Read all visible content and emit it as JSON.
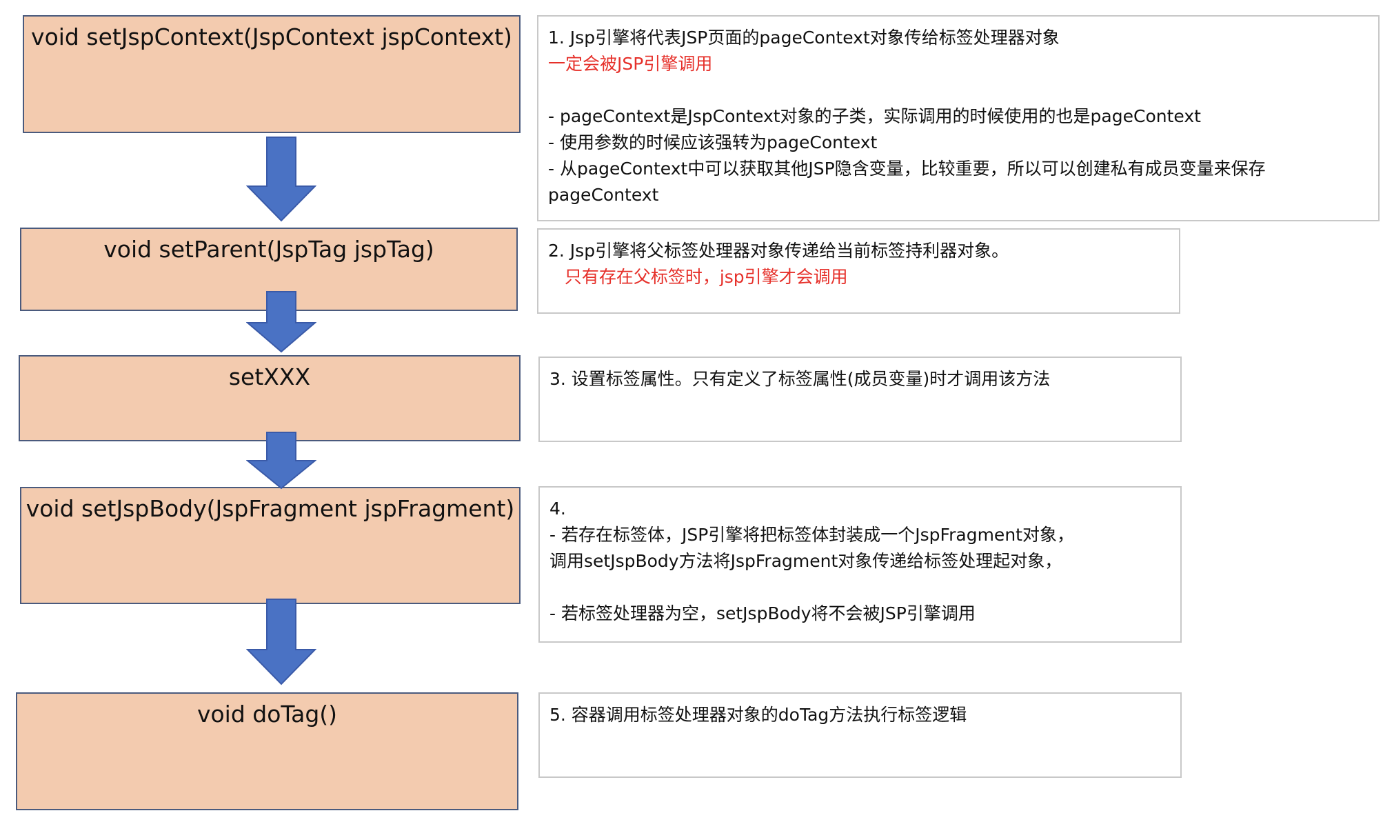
{
  "colors": {
    "step_fill": "#f3cbaf",
    "step_border": "#4a5a7d",
    "arrow_fill": "#4a72c4",
    "arrow_stroke": "#3a5aa8",
    "note_border": "#c8c8c8",
    "highlight_text": "#e6302a"
  },
  "steps": [
    {
      "label": "void setJspContext(JspContext jspContext)"
    },
    {
      "label": "void setParent(JspTag jspTag)"
    },
    {
      "label": "setXXX"
    },
    {
      "label": "void setJspBody(JspFragment jspFragment)"
    },
    {
      "label": "void doTag()"
    }
  ],
  "notes": [
    {
      "lines": [
        {
          "text": "1. Jsp引擎将代表JSP页面的pageContext对象传给标签处理器对象",
          "highlight": false
        },
        {
          "text": "一定会被JSP引擎调用",
          "highlight": true
        },
        {
          "text": "",
          "highlight": false
        },
        {
          "text": "- pageContext是JspContext对象的子类，实际调用的时候使用的也是pageContext",
          "highlight": false
        },
        {
          "text": "- 使用参数的时候应该强转为pageContext",
          "highlight": false
        },
        {
          "text": "- 从pageContext中可以获取其他JSP隐含变量，比较重要，所以可以创建私有成员变量来保存",
          "highlight": false
        },
        {
          "text": "pageContext",
          "highlight": false
        }
      ]
    },
    {
      "lines": [
        {
          "text": "2. Jsp引擎将父标签处理器对象传递给当前标签持利器对象。",
          "highlight": false
        },
        {
          "text": "   只有存在父标签时，jsp引擎才会调用",
          "highlight": true
        }
      ]
    },
    {
      "lines": [
        {
          "text": "3. 设置标签属性。只有定义了标签属性(成员变量)时才调用该方法",
          "highlight": false
        }
      ]
    },
    {
      "lines": [
        {
          "text": "4.",
          "highlight": false
        },
        {
          "text": "- 若存在标签体，JSP引擎将把标签体封装成一个JspFragment对象，",
          "highlight": false
        },
        {
          "text": "调用setJspBody方法将JspFragment对象传递给标签处理起对象，",
          "highlight": false
        },
        {
          "text": "",
          "highlight": false
        },
        {
          "text": "- 若标签处理器为空，setJspBody将不会被JSP引擎调用",
          "highlight": false
        }
      ]
    },
    {
      "lines": [
        {
          "text": "5. 容器调用标签处理器对象的doTag方法执行标签逻辑",
          "highlight": false
        }
      ]
    }
  ]
}
